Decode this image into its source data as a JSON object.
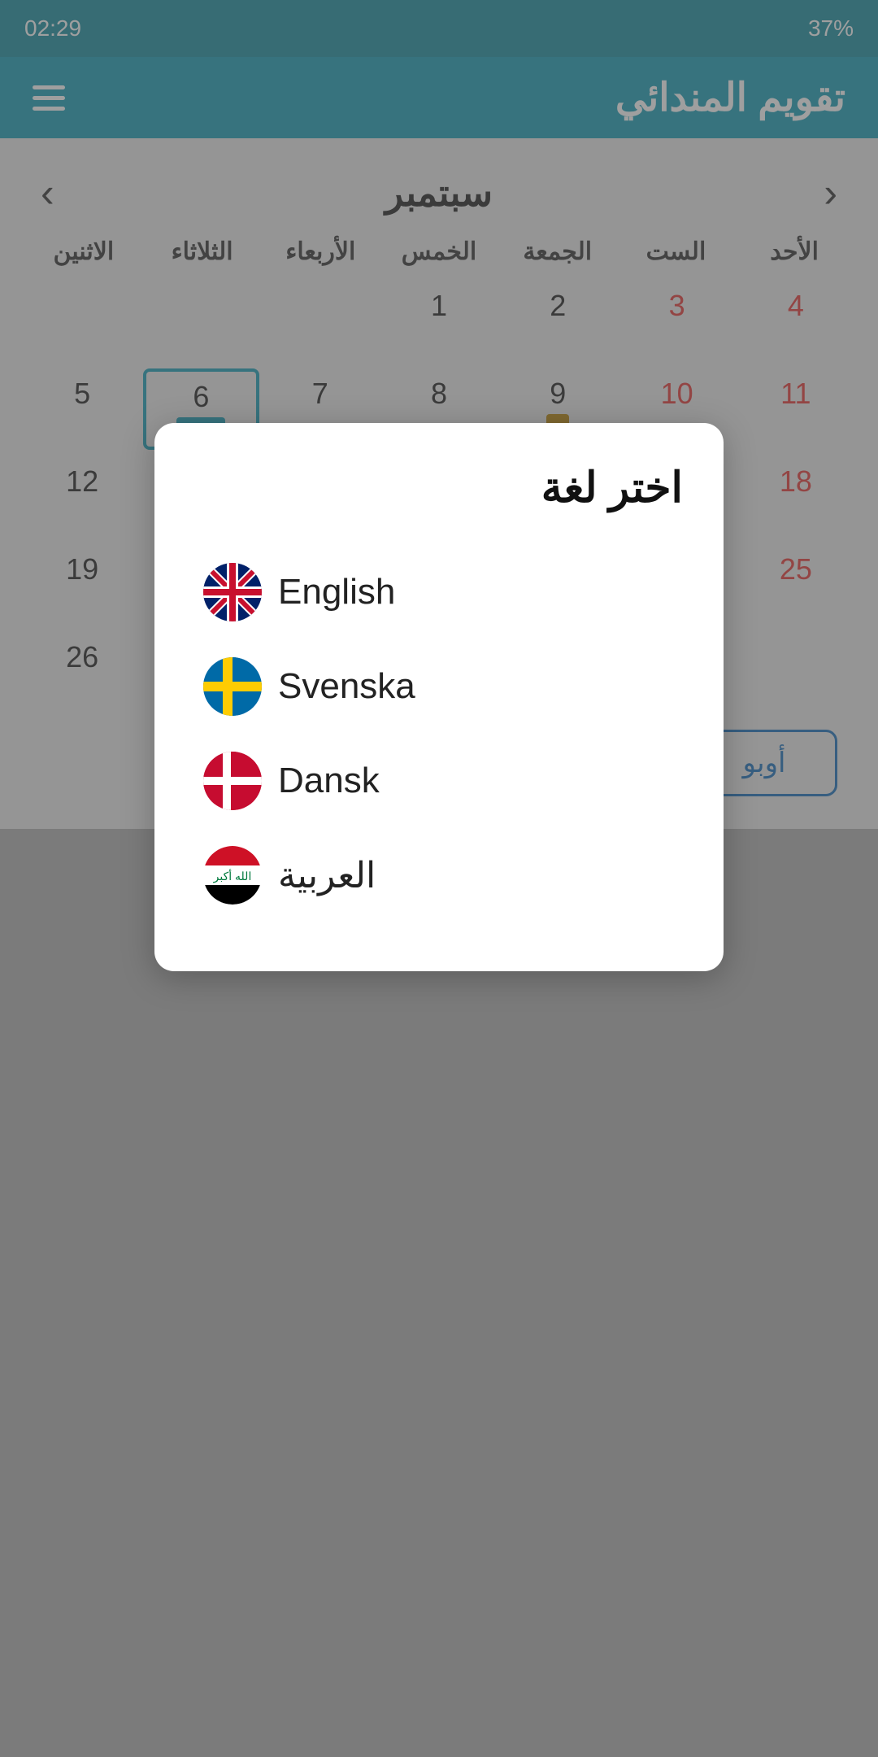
{
  "statusBar": {
    "time": "02:29",
    "battery": "37%"
  },
  "header": {
    "title": "تقويم المندائي",
    "menuIcon": "hamburger"
  },
  "calendar": {
    "monthName": "سبتمبر",
    "prevArrow": "‹",
    "nextArrow": "›",
    "weekdays": [
      "الأحد",
      "الست",
      "الجمعة",
      "الخمس",
      "الأربعاء",
      "الثلاثاء",
      "الاثنين"
    ],
    "rows": [
      [
        {
          "num": "4",
          "red": true,
          "selected": false,
          "dot": false,
          "bar": false
        },
        {
          "num": "3",
          "red": true,
          "selected": false,
          "dot": false,
          "bar": false
        },
        {
          "num": "2",
          "red": false,
          "selected": false,
          "dot": false,
          "bar": false
        },
        {
          "num": "1",
          "red": false,
          "selected": false,
          "dot": false,
          "bar": false
        },
        {
          "num": "",
          "red": false,
          "selected": false,
          "dot": false,
          "bar": false
        },
        {
          "num": "",
          "red": false,
          "selected": false,
          "dot": false,
          "bar": false
        },
        {
          "num": "",
          "red": false,
          "selected": false,
          "dot": false,
          "bar": false
        }
      ],
      [
        {
          "num": "11",
          "red": true,
          "selected": false,
          "dot": false,
          "bar": false
        },
        {
          "num": "10",
          "red": true,
          "selected": false,
          "dot": false,
          "bar": false
        },
        {
          "num": "9",
          "red": false,
          "selected": false,
          "dot": true,
          "bar": false
        },
        {
          "num": "8",
          "red": false,
          "selected": false,
          "dot": false,
          "bar": false
        },
        {
          "num": "7",
          "red": false,
          "selected": false,
          "dot": false,
          "bar": false
        },
        {
          "num": "6",
          "red": false,
          "selected": true,
          "dot": false,
          "bar": true
        },
        {
          "num": "5",
          "red": false,
          "selected": false,
          "dot": false,
          "bar": false
        }
      ],
      [
        {
          "num": "18",
          "red": true,
          "selected": false,
          "dot": false,
          "bar": false
        },
        {
          "num": "",
          "red": false,
          "selected": false,
          "dot": false,
          "bar": false
        },
        {
          "num": "",
          "red": false,
          "selected": false,
          "dot": false,
          "bar": false
        },
        {
          "num": "",
          "red": false,
          "selected": false,
          "dot": false,
          "bar": false
        },
        {
          "num": "",
          "red": false,
          "selected": false,
          "dot": false,
          "bar": false
        },
        {
          "num": "",
          "red": false,
          "selected": false,
          "dot": false,
          "bar": false
        },
        {
          "num": "12",
          "red": false,
          "selected": false,
          "dot": false,
          "bar": false
        }
      ],
      [
        {
          "num": "25",
          "red": true,
          "selected": false,
          "dot": false,
          "bar": false
        },
        {
          "num": "",
          "red": false,
          "selected": false,
          "dot": false,
          "bar": false
        },
        {
          "num": "",
          "red": false,
          "selected": false,
          "dot": false,
          "bar": false
        },
        {
          "num": "",
          "red": false,
          "selected": false,
          "dot": false,
          "bar": false
        },
        {
          "num": "",
          "red": false,
          "selected": false,
          "dot": false,
          "bar": false
        },
        {
          "num": "",
          "red": false,
          "selected": false,
          "dot": false,
          "bar": false
        },
        {
          "num": "19",
          "red": false,
          "selected": false,
          "dot": false,
          "bar": false
        }
      ],
      [
        {
          "num": "",
          "red": false,
          "selected": false,
          "dot": false,
          "bar": false
        },
        {
          "num": "",
          "red": false,
          "selected": false,
          "dot": false,
          "bar": false
        },
        {
          "num": "",
          "red": false,
          "selected": false,
          "dot": false,
          "bar": false
        },
        {
          "num": "",
          "red": false,
          "selected": false,
          "dot": false,
          "bar": false
        },
        {
          "num": "",
          "red": false,
          "selected": false,
          "dot": false,
          "bar": false
        },
        {
          "num": "",
          "red": false,
          "selected": false,
          "dot": false,
          "bar": false
        },
        {
          "num": "26",
          "red": false,
          "selected": false,
          "dot": false,
          "bar": false
        }
      ]
    ],
    "bottomButtons": [
      {
        "label": "أوبو",
        "id": "btn-oppo"
      }
    ]
  },
  "dialog": {
    "title": "اختر لغة",
    "languages": [
      {
        "label": "English",
        "flagType": "uk"
      },
      {
        "label": "Svenska",
        "flagType": "se"
      },
      {
        "label": "Dansk",
        "flagType": "dk"
      },
      {
        "label": "العربية",
        "flagType": "iq"
      }
    ]
  }
}
